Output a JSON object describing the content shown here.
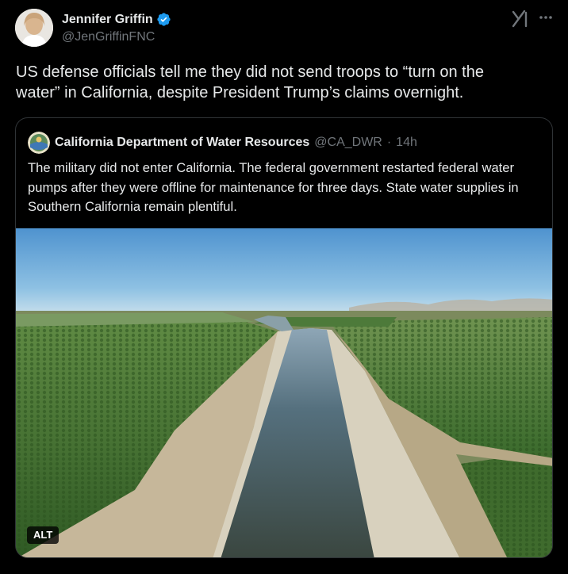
{
  "author": {
    "display_name": "Jennifer Griffin",
    "handle": "@JenGriffinFNC",
    "verified": true,
    "avatar_icon": "avatar-photo"
  },
  "header_icons": {
    "grok": "grok-icon",
    "more": "more-icon"
  },
  "tweet": {
    "text": "US defense officials tell me they did not send troops to “turn on the\nwater” in California, despite President Trump’s claims overnight."
  },
  "quote": {
    "display_name": "California Department of Water Resources",
    "handle": "@CA_DWR",
    "separator": "·",
    "time": "14h",
    "text": "The military did not enter California. The federal government restarted federal water pumps after they were offline for maintenance for three days. State water supplies in Southern California remain plentiful.",
    "media_alt_badge": "ALT"
  },
  "colors": {
    "background": "#000000",
    "text_primary": "#e7e9ea",
    "text_secondary": "#71767b",
    "border": "#2f3336",
    "verified_blue": "#1d9bf0"
  }
}
